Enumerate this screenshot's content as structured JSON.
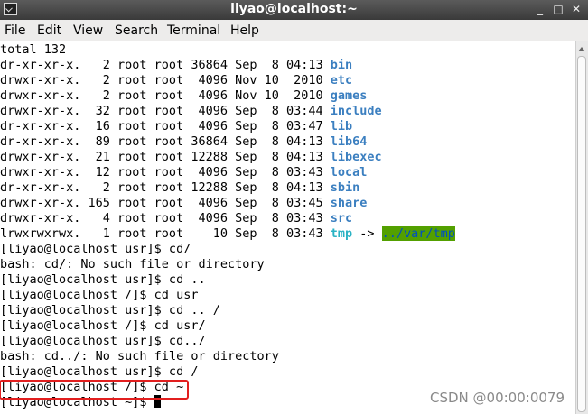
{
  "window": {
    "title": "liyao@localhost:~",
    "controls": [
      "_",
      "□",
      "✕"
    ]
  },
  "menu": [
    "File",
    "Edit",
    "View",
    "Search",
    "Terminal",
    "Help"
  ],
  "terminal_lines": [
    {
      "text": "total 132"
    },
    {
      "text": "dr-xr-xr-x.   2 root root 36864 Sep  8 04:13 ",
      "name": "bin"
    },
    {
      "text": "drwxr-xr-x.   2 root root  4096 Nov 10  2010 ",
      "name": "etc"
    },
    {
      "text": "drwxr-xr-x.   2 root root  4096 Nov 10  2010 ",
      "name": "games"
    },
    {
      "text": "drwxr-xr-x.  32 root root  4096 Sep  8 03:44 ",
      "name": "include"
    },
    {
      "text": "dr-xr-xr-x.  16 root root  4096 Sep  8 03:47 ",
      "name": "lib"
    },
    {
      "text": "dr-xr-xr-x.  89 root root 36864 Sep  8 04:13 ",
      "name": "lib64"
    },
    {
      "text": "drwxr-xr-x.  21 root root 12288 Sep  8 04:13 ",
      "name": "libexec"
    },
    {
      "text": "drwxr-xr-x.  12 root root  4096 Sep  8 03:43 ",
      "name": "local"
    },
    {
      "text": "dr-xr-xr-x.   2 root root 12288 Sep  8 04:13 ",
      "name": "sbin"
    },
    {
      "text": "drwxr-xr-x. 165 root root  4096 Sep  8 03:45 ",
      "name": "share"
    },
    {
      "text": "drwxr-xr-x.   4 root root  4096 Sep  8 03:43 ",
      "name": "src"
    },
    {
      "text": "lrwxrwxrwx.   1 root root    10 Sep  8 03:43 ",
      "name": "tmp",
      "arrow": " -> ",
      "target": "../var/tmp"
    },
    {
      "text": "[liyao@localhost usr]$ cd/"
    },
    {
      "text": "bash: cd/: No such file or directory"
    },
    {
      "text": "[liyao@localhost usr]$ cd .."
    },
    {
      "text": "[liyao@localhost /]$ cd usr"
    },
    {
      "text": "[liyao@localhost usr]$ cd .. /"
    },
    {
      "text": "[liyao@localhost /]$ cd usr/"
    },
    {
      "text": "[liyao@localhost usr]$ cd../"
    },
    {
      "text": "bash: cd../: No such file or directory"
    },
    {
      "text": "[liyao@localhost usr]$ cd /"
    },
    {
      "text": "[liyao@localhost /]$ cd ~"
    },
    {
      "text": "[liyao@localhost ~]$ ",
      "cursor": true
    }
  ],
  "watermark": "CSDN @00:00:0079",
  "colors": {
    "dir": "#3b7fc0",
    "symlink": "#2ab3c4",
    "symlink_target_bg": "#53a000",
    "highlight": "#e21f1f"
  }
}
